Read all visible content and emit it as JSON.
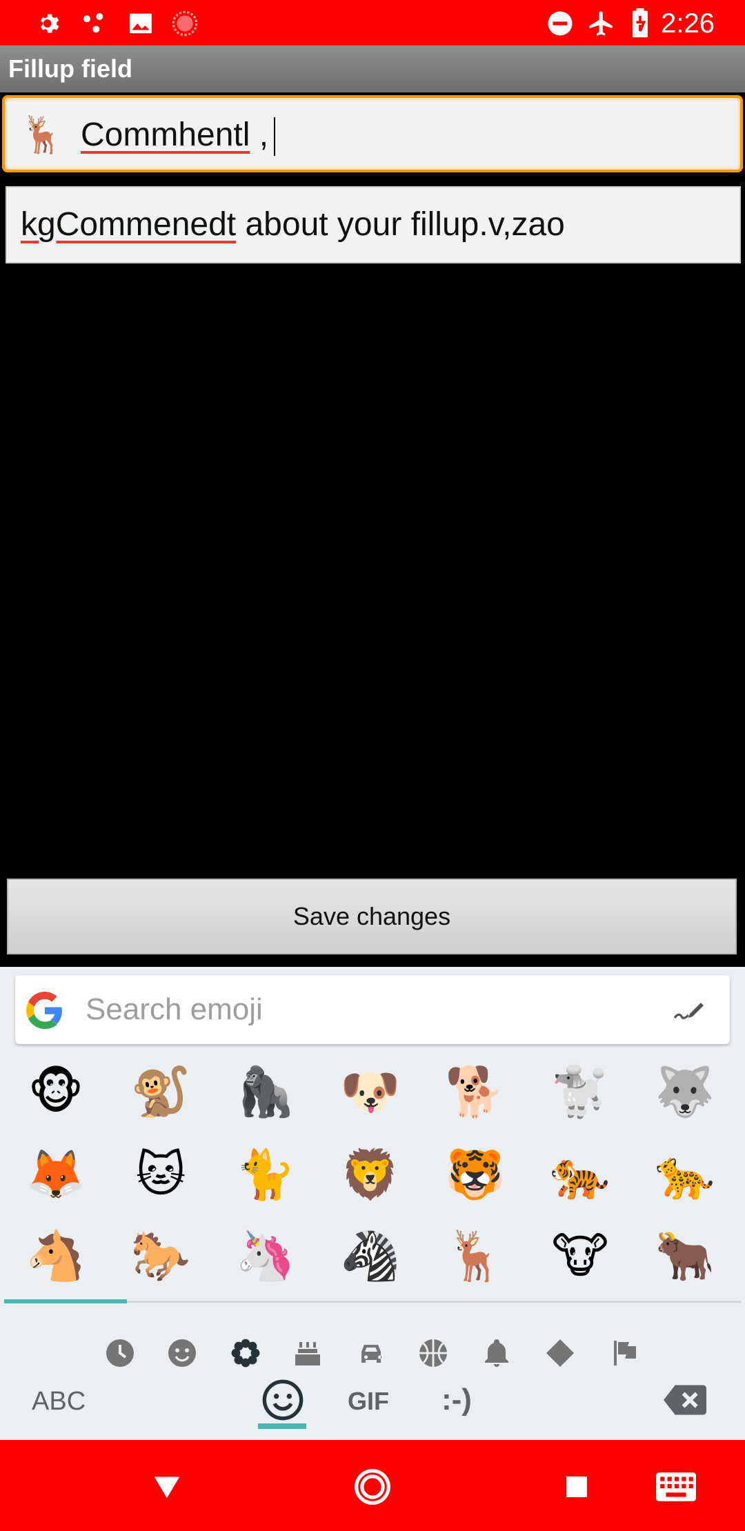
{
  "status_bar": {
    "time": "2:26",
    "left_icons": [
      "settings-icon",
      "share-dots-icon",
      "image-icon",
      "record-icon"
    ],
    "right_icons": [
      "do-not-disturb-icon",
      "airplane-mode-icon",
      "battery-charging-icon"
    ]
  },
  "titlebar": {
    "title": "Fillup field"
  },
  "field1": {
    "emoji": "🦌",
    "text_misspelled": "Commhentl",
    "text_rest": " ,"
  },
  "field2": {
    "text_misspelled": "kgCommenedt",
    "text_rest": " about your fillup.v,zao"
  },
  "save_button": {
    "label": "Save changes"
  },
  "keyboard": {
    "search_placeholder": "Search emoji",
    "emoji_rows": [
      [
        "🐵",
        "🐒",
        "🦍",
        "🐶",
        "🐕",
        "🐩",
        "🐺"
      ],
      [
        "🦊",
        "🐱",
        "🐈",
        "🦁",
        "🐯",
        "🐅",
        "🐆"
      ],
      [
        "🐴",
        "🐎",
        "🦄",
        "🦓",
        "🦌",
        "🐮",
        "🐂"
      ]
    ],
    "categories": [
      "recent-icon",
      "smileys-icon",
      "nature-icon",
      "food-icon",
      "travel-icon",
      "activities-icon",
      "objects-icon",
      "symbols-icon",
      "flags-icon"
    ],
    "active_category": "nature-icon",
    "abc_label": "ABC",
    "gif_label": "GIF",
    "emoticon_label": ":-)"
  },
  "navbar": {
    "buttons": [
      "back-icon",
      "home-icon",
      "recents-icon",
      "keyboard-icon"
    ]
  },
  "colors": {
    "status_bar": "#ff0000",
    "focus_border": "#ff9800",
    "accent": "#4db6ac"
  }
}
